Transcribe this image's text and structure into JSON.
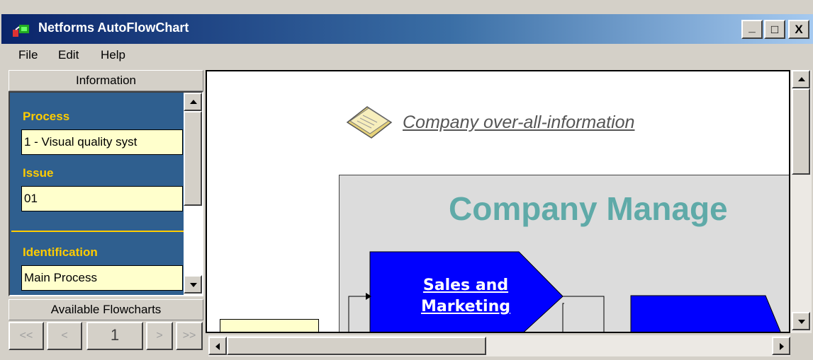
{
  "window": {
    "title": "Netforms AutoFlowChart",
    "buttons": {
      "minimize": "_",
      "maximize": "□",
      "close": "X"
    }
  },
  "menu": [
    {
      "label": "File"
    },
    {
      "label": "Edit"
    },
    {
      "label": "Help"
    }
  ],
  "left_panel": {
    "information_header": "Information",
    "fields": {
      "process_label": "Process",
      "process_value": "1 - Visual quality syst",
      "issue_label": "Issue",
      "issue_value": "01",
      "identification_label": "Identification",
      "identification_value": "Main Process"
    },
    "flowcharts_header": "Available Flowcharts",
    "nav": {
      "first": "<<",
      "prev": "<",
      "page": "1",
      "next": ">",
      "last": ">>"
    }
  },
  "canvas": {
    "company_info_link": "Company over-all-information",
    "management_title": "Company Manage",
    "sales_node_label_1": "Sales and",
    "sales_node_label_2": "Marketing"
  },
  "colors": {
    "info_panel_bg": "#2f5f8f",
    "label_yellow": "#ffcc00",
    "field_bg": "#ffffcc",
    "flow_node_blue": "#0000ff",
    "management_title": "#5faaa8"
  }
}
